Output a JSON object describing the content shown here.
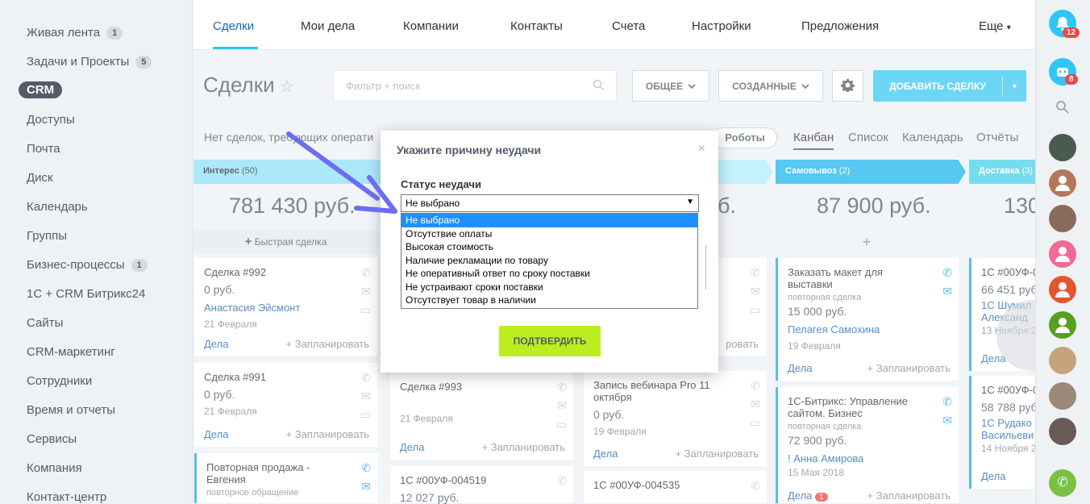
{
  "sidebar": {
    "items": [
      {
        "label": "Живая лента",
        "count": "1"
      },
      {
        "label": "Задачи и Проекты",
        "count": "5"
      },
      {
        "label": "CRM",
        "active": true
      },
      {
        "label": "Доступы"
      },
      {
        "label": "Почта"
      },
      {
        "label": "Диск"
      },
      {
        "label": "Календарь"
      },
      {
        "label": "Группы"
      },
      {
        "label": "Бизнес-процессы",
        "count": "1"
      },
      {
        "label": "1С + CRM Битрикс24"
      },
      {
        "label": "Сайты"
      },
      {
        "label": "CRM-маркетинг"
      },
      {
        "label": "Сотрудники"
      },
      {
        "label": "Время и отчеты"
      },
      {
        "label": "Сервисы"
      },
      {
        "label": "Компания"
      },
      {
        "label": "Контакт-центр"
      }
    ]
  },
  "topnav": {
    "tabs": [
      "Сделки",
      "Мои дела",
      "Компании",
      "Контакты",
      "Счета",
      "Настройки",
      "Предложения"
    ],
    "more": "Еще"
  },
  "header": {
    "title": "Сделки",
    "filter_placeholder": "Фильтр + поиск",
    "general_btn": "ОБЩЕЕ",
    "created_btn": "СОЗДАННЫЕ",
    "add_btn": "ДОБАВИТЬ СДЕЛКУ"
  },
  "subbar": {
    "no_deals_text": "Нет сделок, требующих операти",
    "robots": "Роботы",
    "views": [
      "Канбан",
      "Список",
      "Календарь",
      "Отчёты"
    ]
  },
  "columns": [
    {
      "name": "Интерес",
      "count": "(50)",
      "sum": "781 430 руб.",
      "color": "#8fe2f8",
      "quick": "Быстрая сделка"
    },
    {
      "name": "",
      "count": "",
      "sum": "б.",
      "color": "#b0ecfb"
    },
    {
      "name": "Самовывоз",
      "count": "(2)",
      "sum": "87 900 руб.",
      "color": "#1eb6ee"
    },
    {
      "name": "Доставка",
      "count": "(3)",
      "sum": "130",
      "color": "#47d0ea"
    }
  ],
  "cards": {
    "c1": {
      "title": "Сделка #992",
      "price": "0 руб.",
      "contact": "Анастасия Эйсмонт",
      "date": "21 Февраля",
      "foot_a": "Дела",
      "foot_b": "+ Запланировать"
    },
    "c2": {
      "title": "Сделка #991",
      "price": "0 руб.",
      "date": "21 Февраля",
      "foot_a": "Дела",
      "foot_b": "+ Запланировать"
    },
    "c3": {
      "title": "Повторная продажа - Евгения",
      "sub": "повторное обращение"
    },
    "c4": {
      "title_tail": "ы",
      "foot_b": "ровать"
    },
    "c5": {
      "title": "Сделка #993",
      "date": "21 Февраля",
      "foot_a": "Дела",
      "foot_b": "+ Запланировать"
    },
    "c6": {
      "title": "1С #00УФ-004519",
      "price": "12 027 руб."
    },
    "c7": {
      "title": "Запись вебинара Pro 11 октября",
      "price": "0 руб.",
      "date": "19 Февраля",
      "foot_a": "Дела",
      "foot_b": "+ Запланировать"
    },
    "c8": {
      "title": "1С #00УФ-004535"
    },
    "c9": {
      "title": "Заказать макет для выставки",
      "sub": "повторная сделка",
      "price": "15 000 руб.",
      "contact": "Пелагея Самохина",
      "date": "19 Февраля",
      "foot_a": "Дела",
      "foot_b": "+ Запланировать"
    },
    "c10": {
      "title": "1С-Битрикс: Управление сайтом. Бизнес",
      "sub": "повторная сделка",
      "price": "72 900 руб.",
      "contact": "! Анна Амирова",
      "date": "15 Мая 2018",
      "foot_a": "Дела",
      "badge": "1",
      "foot_b": "+ Запланировать"
    },
    "c11": {
      "title": "1С #00УФ-0",
      "price": "66 451 руб",
      "contact1": "1С Шумил",
      "contact2": "Александ",
      "date": "13 Ноября 2",
      "foot_a": "Дела"
    },
    "c12": {
      "title": "1С #00УФ-0",
      "price": "58 788 руб",
      "contact1": "1С Рудако",
      "contact2": "Васильеви",
      "date": "14 Ноября 2",
      "foot_a": "Дела"
    }
  },
  "modal": {
    "title": "Укажите причину неудачи",
    "close": "×",
    "status_label": "Статус неудачи",
    "selected": "Не выбрано",
    "options": [
      "Не выбрано",
      "Отсутствие оплаты",
      "Высокая стоимость",
      "Наличие рекламации по товару",
      "Не оперативный ответ по сроку поставки",
      "Не устраивают сроки поставки",
      "Отсутствует товар в наличии"
    ],
    "confirm": "ПОДТВЕРДИТЬ"
  },
  "right_panel": {
    "notif_badge": "12",
    "bot_badge": "8"
  }
}
